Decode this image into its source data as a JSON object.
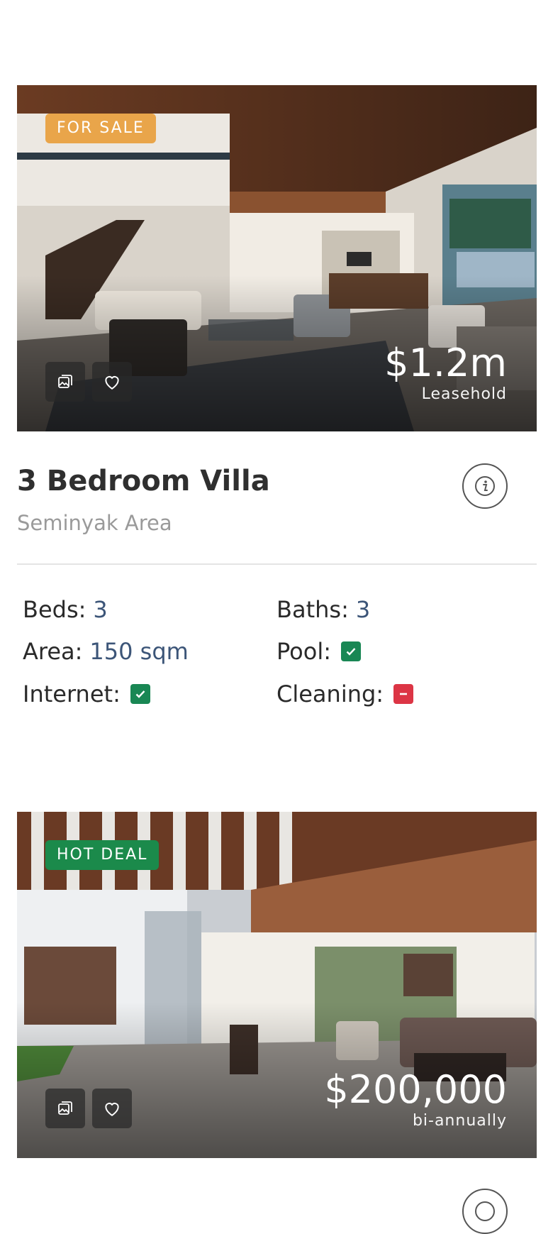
{
  "colors": {
    "for_sale_badge": "#e9a54a",
    "hot_deal_badge": "#1b8a4b",
    "check_green": "#198754",
    "cross_red": "#dc3545",
    "value_blue": "#3c5578"
  },
  "listings": [
    {
      "badge": "FOR SALE",
      "price": "$1.2m",
      "price_note": "Leasehold",
      "title": "3 Bedroom Villa",
      "area_name": "Seminyak Area",
      "features": {
        "beds_label": "Beds:",
        "beds_value": "3",
        "baths_label": "Baths:",
        "baths_value": "3",
        "area_label": "Area:",
        "area_value": "150 sqm",
        "pool_label": "Pool:",
        "pool": true,
        "internet_label": "Internet:",
        "internet": true,
        "cleaning_label": "Cleaning:",
        "cleaning": false
      }
    },
    {
      "badge": "HOT DEAL",
      "price": "$200,000",
      "price_note": "bi-annually"
    }
  ],
  "icons": {
    "gallery": "gallery-icon",
    "favorite": "heart-icon",
    "info": "info-icon",
    "check": "check-icon",
    "minus": "minus-icon"
  }
}
